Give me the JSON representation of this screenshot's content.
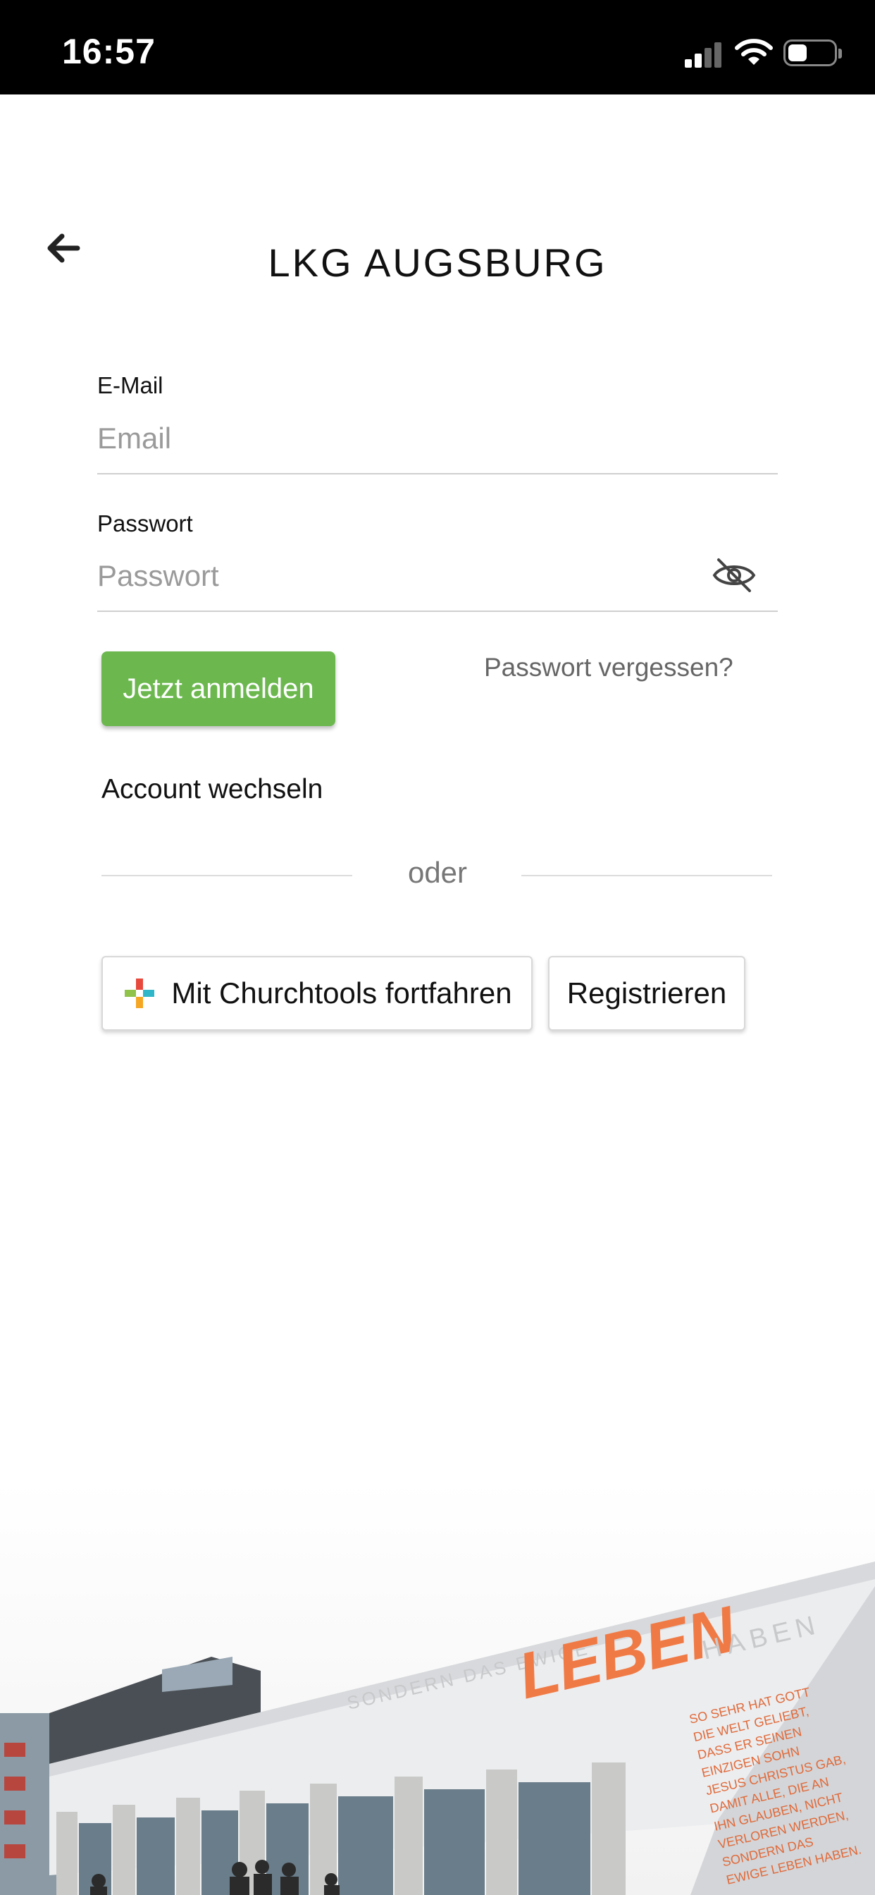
{
  "status_bar": {
    "time": "16:57"
  },
  "header": {
    "title": "LKG AUGSBURG"
  },
  "form": {
    "email": {
      "label": "E-Mail",
      "placeholder": "Email",
      "value": ""
    },
    "password": {
      "label": "Passwort",
      "placeholder": "Passwort",
      "value": ""
    },
    "login_button": "Jetzt anmelden",
    "forgot_link": "Passwort vergessen?",
    "switch_account": "Account wechseln",
    "divider_text": "oder",
    "churchtools_button": "Mit Churchtools fortfahren",
    "register_button": "Registrieren"
  },
  "banner": {
    "word_left": "SONDERN DAS EWIGE",
    "word_main": "LEBEN",
    "word_right": "HABEN",
    "verse_lines": [
      "SO SEHR HAT GOTT",
      "DIE WELT GELIEBT,",
      "DASS ER SEINEN",
      "EINZIGEN SOHN",
      "JESUS CHRISTUS GAB,",
      "DAMIT ALLE, DIE AN",
      "IHN GLAUBEN, NICHT",
      "VERLOREN WERDEN,",
      "SONDERN DAS",
      "EWIGE LEBEN HABEN."
    ]
  },
  "colors": {
    "accent": "#6cb84f",
    "banner_text": "#f07a45"
  }
}
